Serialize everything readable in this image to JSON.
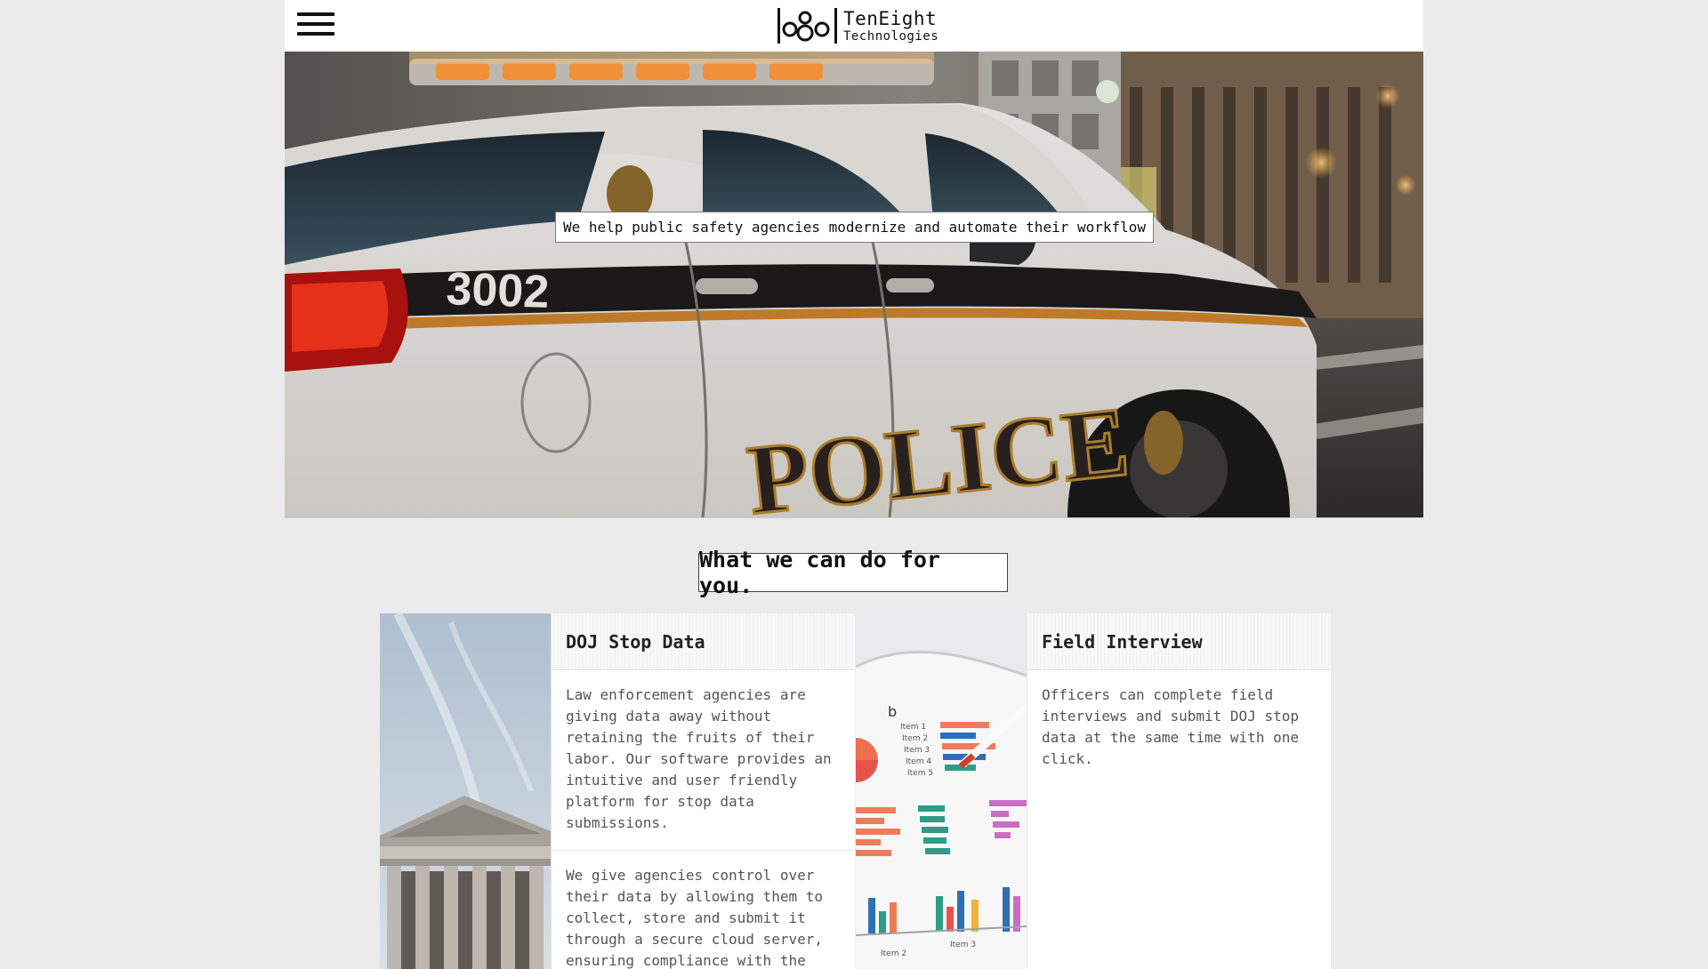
{
  "header": {
    "menu_icon": "hamburger-icon",
    "logo_line1": "TenEight",
    "logo_line2": "Technologies"
  },
  "hero": {
    "caption": "We help public safety agencies modernize and automate their workflow",
    "car_number": "3002",
    "car_text": "POLICE"
  },
  "services": {
    "title": "What we can do for you.",
    "cards": [
      {
        "title": "DOJ Stop Data",
        "image": "courthouse-columns-photo",
        "paragraphs": [
          "Law enforcement agencies are giving data away without retaining the fruits of their labor. Our software provides an intuitive and user friendly platform for stop data submissions.",
          "We give agencies control over their data by allowing them to collect, store and submit it through a secure cloud server, ensuring compliance with the"
        ]
      },
      {
        "title": "Field Interview",
        "image": "tablet-charts-photo",
        "paragraphs": [
          "Officers can complete field interviews and submit DOJ stop data at the same time with one click."
        ]
      }
    ]
  },
  "tablet_chart_labels": {
    "panel_letter": "b",
    "items": [
      "Item 1",
      "Item 2",
      "Item 3",
      "Item 4",
      "Item 5"
    ],
    "bottom_items": [
      "Item 2",
      "Item 3"
    ]
  }
}
